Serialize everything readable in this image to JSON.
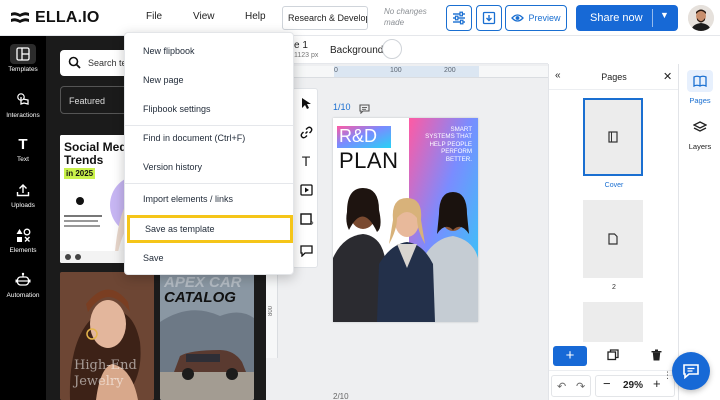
{
  "app": {
    "logo": "ELLA.IO"
  },
  "top_menu": [
    {
      "label": "File"
    },
    {
      "label": "View"
    },
    {
      "label": "Help"
    }
  ],
  "doc": {
    "title": "Research & Development",
    "status": "No changes made"
  },
  "actions": {
    "preview": "Preview",
    "share": "Share now"
  },
  "left_rail": [
    {
      "label": "Templates",
      "icon": "layout-icon"
    },
    {
      "label": "Interactions",
      "icon": "tap-icon"
    },
    {
      "label": "Text",
      "icon": "text-icon"
    },
    {
      "label": "Uploads",
      "icon": "upload-icon"
    },
    {
      "label": "Elements",
      "icon": "shapes-icon"
    },
    {
      "label": "Automation",
      "icon": "robot-icon"
    }
  ],
  "templates_panel": {
    "search_placeholder": "Search templates",
    "filter_label": "Featured",
    "cards": {
      "social": {
        "line1": "Social Media",
        "line2": "Trends",
        "line3": "in 2025"
      },
      "jewelry": {
        "line1": "High-End",
        "line2": "Jewelry"
      },
      "car": {
        "line1": "APEX CAR",
        "line2": "CATALOG"
      }
    }
  },
  "file_menu": {
    "items": [
      {
        "label": "New flipbook"
      },
      {
        "label": "New page"
      },
      {
        "label": "Flipbook settings"
      },
      {
        "label": "Find in document (Ctrl+F)"
      },
      {
        "label": "Version history"
      },
      {
        "label": "Import elements / links"
      },
      {
        "label": "Save as template",
        "highlighted": true
      },
      {
        "label": "Save"
      }
    ]
  },
  "canvas": {
    "page_name_fragment": "e 1",
    "size_fragment": "1123 px",
    "background_label": "Background",
    "page_counter": "1/10",
    "page_counter_next": "2/10",
    "ruler_marks": [
      "0",
      "100",
      "200"
    ],
    "vertical_ruler_mark": "800",
    "page_content": {
      "title_line1": "R&D",
      "title_line2": "PLAN",
      "tagline": [
        "SMART",
        "SYSTEMS THAT",
        "HELP PEOPLE",
        "PERFORM",
        "BETTER."
      ]
    }
  },
  "pages_panel": {
    "title": "Pages",
    "pages": [
      {
        "label": "Cover"
      },
      {
        "label": "2"
      }
    ],
    "zoom": "29%"
  },
  "right_rail": [
    {
      "label": "Pages",
      "icon": "book-icon"
    },
    {
      "label": "Layers",
      "icon": "layers-icon"
    }
  ],
  "colors": {
    "primary": "#1769d6",
    "highlight": "#f5c518",
    "rail_bg": "#000000"
  }
}
